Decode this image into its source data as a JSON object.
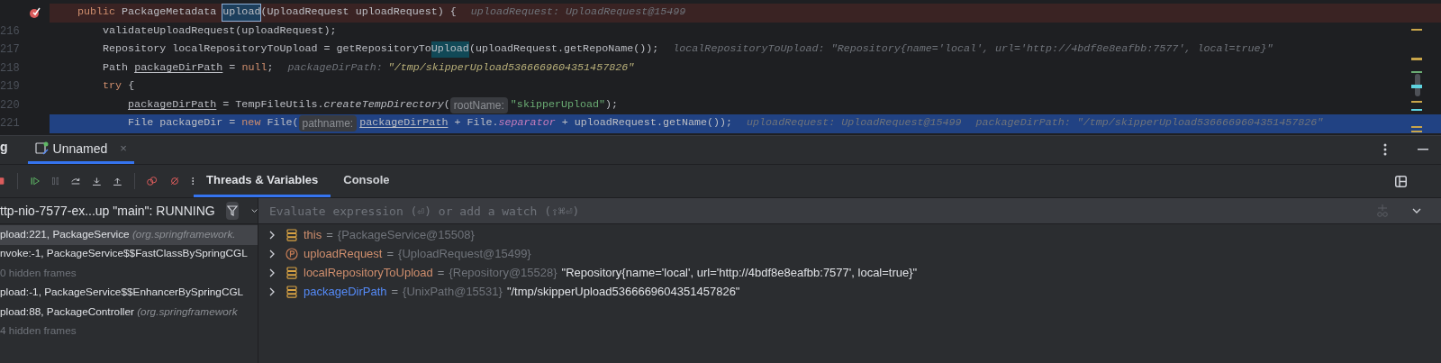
{
  "editor": {
    "lines": [
      {
        "breakpoint": true,
        "current": false,
        "tokens": [
          {
            "kind": "keyword",
            "text": "public "
          },
          {
            "kind": "plain",
            "text": "PackageMetadata "
          },
          {
            "kind": "caret_match",
            "text": "upload"
          },
          {
            "kind": "plain",
            "text": "(UploadRequest uploadRequest) {"
          },
          {
            "kind": "inlay",
            "text": "uploadRequest: UploadRequest@15499"
          }
        ]
      },
      {
        "number": "216",
        "breakpoint": false,
        "current": false,
        "tokens": [
          {
            "kind": "plain",
            "text": "    validateUploadRequest(uploadRequest);"
          }
        ]
      },
      {
        "number": "217",
        "breakpoint": false,
        "current": false,
        "tokens": [
          {
            "kind": "plain",
            "text": "    Repository localRepositoryToUpload = getRepositoryTo"
          },
          {
            "kind": "match",
            "text": "Upload"
          },
          {
            "kind": "plain",
            "text": "(uploadRequest.getRepoName());"
          },
          {
            "kind": "inlay",
            "text": "localRepositoryToUpload: \"Repository{name='local', url='http://4bdf8e8eafbb:7577', local=true}\""
          }
        ]
      },
      {
        "number": "218",
        "breakpoint": false,
        "current": false,
        "tokens": [
          {
            "kind": "plain",
            "text": "    Path "
          },
          {
            "kind": "var",
            "text": "packageDirPath"
          },
          {
            "kind": "plain",
            "text": " = "
          },
          {
            "kind": "keyword",
            "text": "null"
          },
          {
            "kind": "plain",
            "text": ";"
          },
          {
            "kind": "inlay",
            "text": "packageDirPath:"
          },
          {
            "kind": "inlay_value",
            "text": "\"/tmp/skipperUpload5366669604351457826\""
          }
        ]
      },
      {
        "number": "219",
        "breakpoint": false,
        "current": false,
        "tokens": [
          {
            "kind": "keyword",
            "text": "    try"
          },
          {
            "kind": "plain",
            "text": " {"
          }
        ]
      },
      {
        "number": "220",
        "breakpoint": false,
        "current": false,
        "tokens": [
          {
            "kind": "var",
            "text": "        packageDirPath"
          },
          {
            "kind": "plain",
            "text": " = TempFileUtils."
          },
          {
            "kind": "static",
            "text": "createTempDirectory"
          },
          {
            "kind": "plain",
            "text": "("
          },
          {
            "kind": "hint",
            "text": "rootName:"
          },
          {
            "kind": "string",
            "text": "\"skipperUpload\""
          },
          {
            "kind": "plain",
            "text": ");"
          }
        ]
      },
      {
        "number": "221",
        "breakpoint": false,
        "current": true,
        "tokens": [
          {
            "kind": "plain",
            "text": "        File packageDir = "
          },
          {
            "kind": "keyword",
            "text": "new"
          },
          {
            "kind": "plain",
            "text": " File("
          },
          {
            "kind": "hint",
            "text": "pathname:"
          },
          {
            "kind": "var",
            "text": "packageDirPath"
          },
          {
            "kind": "plain",
            "text": " + File."
          },
          {
            "kind": "field",
            "text": "separator"
          },
          {
            "kind": "plain",
            "text": " + uploadRequest.getName());"
          },
          {
            "kind": "inlay",
            "text": "uploadRequest: UploadRequest@15499"
          },
          {
            "kind": "inlay",
            "text": "packageDirPath: \"/tmp/skipperUpload5366669604351457826\""
          }
        ]
      }
    ]
  },
  "debug": {
    "tool_window_title": "g",
    "tabs": [
      {
        "label": "Unnamed",
        "selected": true,
        "close": "×"
      }
    ],
    "panel_tabs": [
      {
        "label": "Threads & Variables",
        "selected": true
      },
      {
        "label": "Console",
        "selected": false
      }
    ],
    "thread": "ttp-nio-7577-ex...up \"main\": RUNNING",
    "frames": [
      {
        "kind": "frame",
        "selected": true,
        "text": "pload:221, PackageService",
        "package": "(org.springframework."
      },
      {
        "kind": "frame",
        "selected": false,
        "text": "nvoke:-1, PackageService$$FastClassBySpringCGL"
      },
      {
        "kind": "hidden",
        "selected": false,
        "text": "0 hidden frames"
      },
      {
        "kind": "frame",
        "selected": false,
        "text": "pload:-1, PackageService$$EnhancerBySpringCGL"
      },
      {
        "kind": "frame",
        "selected": false,
        "text": "pload:88, PackageController",
        "package": "(org.springframework"
      },
      {
        "kind": "hidden",
        "selected": false,
        "text": "4 hidden frames"
      }
    ],
    "watch_field": {
      "placeholder": "Evaluate expression (⏎) or add a watch (⇧⌘⏎)"
    },
    "variables": [
      {
        "kind": "field",
        "name": "this",
        "color": "#cf8e6d",
        "operator": "=",
        "type": "{PackageService@15508}"
      },
      {
        "kind": "parameter",
        "name": "uploadRequest",
        "color": "#cf8e6d",
        "operator": "=",
        "type": "{UploadRequest@15499}"
      },
      {
        "kind": "field",
        "name": "localRepositoryToUpload",
        "color": "#cf8e6d",
        "operator": "=",
        "type": "{Repository@15528}",
        "value": "\"Repository{name='local', url='http://4bdf8e8eafbb:7577', local=true}\""
      },
      {
        "kind": "field",
        "name": "packageDirPath",
        "color": "#548af7",
        "operator": "=",
        "type": "{UnixPath@15531}",
        "value": "\"/tmp/skipperUpload5366669604351457826\""
      }
    ]
  }
}
